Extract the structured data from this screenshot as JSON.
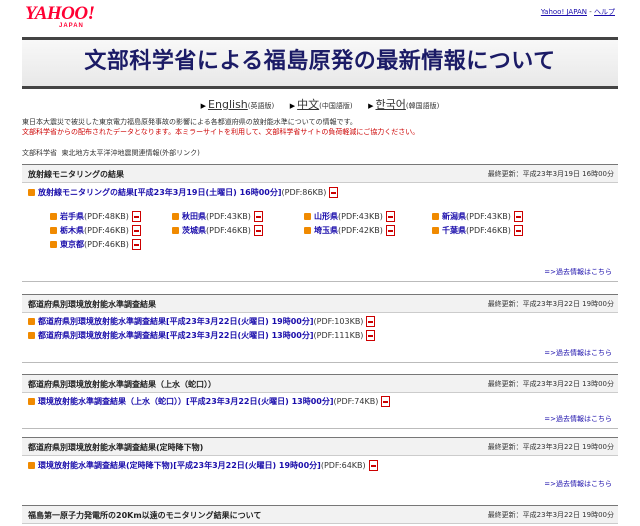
{
  "header": {
    "logo_text": "YAHOO!",
    "logo_sub": "JAPAN",
    "link_yahoo": "Yahoo! JAPAN",
    "link_sep": " - ",
    "link_help": "ヘルプ"
  },
  "page_title": "文部科学省による福島原発の最新情報について",
  "languages": [
    {
      "label": "English",
      "note": "(英語版)"
    },
    {
      "label": "中文",
      "note": "(中国語版)"
    },
    {
      "label": "한국어",
      "note": "(韓国語版)"
    }
  ],
  "intro": {
    "line1": "東日本大震災で被災した東京電力福島原発事故の影響による各都道府県の放射能水準についての情報です。",
    "line2": "文部科学省からの配布されたデータとなります。本ミラーサイトを利用して、文部科学省サイトの負荷軽減にご協力ください。"
  },
  "external": {
    "link1": "文部科学省",
    "link2": "東北地方太平洋沖地震関連情報",
    "suffix": "(外部リンク)"
  },
  "sections": [
    {
      "title": "放射線モニタリングの結果",
      "updated": "最終更新：平成23年3月19日 16時00分",
      "main_link": "放射線モニタリングの結果[平成23年3月19日(土曜日) 16時00分]",
      "main_size": "(PDF:86KB)",
      "prefectures": [
        {
          "name": "岩手県",
          "size": "(PDF:48KB)"
        },
        {
          "name": "秋田県",
          "size": "(PDF:43KB)"
        },
        {
          "name": "山形県",
          "size": "(PDF:43KB)"
        },
        {
          "name": "新潟県",
          "size": "(PDF:43KB)"
        },
        {
          "name": "栃木県",
          "size": "(PDF:46KB)"
        },
        {
          "name": "茨城県",
          "size": "(PDF:46KB)"
        },
        {
          "name": "埼玉県",
          "size": "(PDF:42KB)"
        },
        {
          "name": "千葉県",
          "size": "(PDF:46KB)"
        },
        {
          "name": "東京都",
          "size": "(PDF:46KB)"
        }
      ],
      "more": "過去情報はこちら"
    },
    {
      "title": "都道府県別環境放射能水準調査結果",
      "updated": "最終更新：平成23年3月22日 19時00分",
      "links": [
        {
          "text": "都道府県別環境放射能水準調査結果[平成23年3月22日(火曜日) 19時00分]",
          "size": "(PDF:103KB)"
        },
        {
          "text": "都道府県別環境放射能水準調査結果[平成23年3月22日(火曜日) 13時00分]",
          "size": "(PDF:111KB)"
        }
      ],
      "more": "過去情報はこちら"
    },
    {
      "title": "都道府県別環境放射能水準調査結果（上水（蛇口））",
      "updated": "最終更新：平成23年3月22日 13時00分",
      "links": [
        {
          "text": "環境放射能水準調査結果（上水（蛇口））[平成23年3月22日(火曜日) 13時00分]",
          "size": "(PDF:74KB)"
        }
      ],
      "more": "過去情報はこちら"
    },
    {
      "title": "都道府県別環境放射能水準調査結果(定時降下物)",
      "updated": "最終更新：平成23年3月22日 19時00分",
      "links": [
        {
          "text": "環境放射能水準調査結果(定時降下物)[平成23年3月22日(火曜日) 19時00分]",
          "size": "(PDF:64KB)"
        }
      ],
      "more": "過去情報はこちら"
    },
    {
      "title": "福島第一原子力発電所の20Km以遠のモニタリング結果について",
      "updated": "最終更新：平成23年3月22日 19時00分"
    }
  ]
}
